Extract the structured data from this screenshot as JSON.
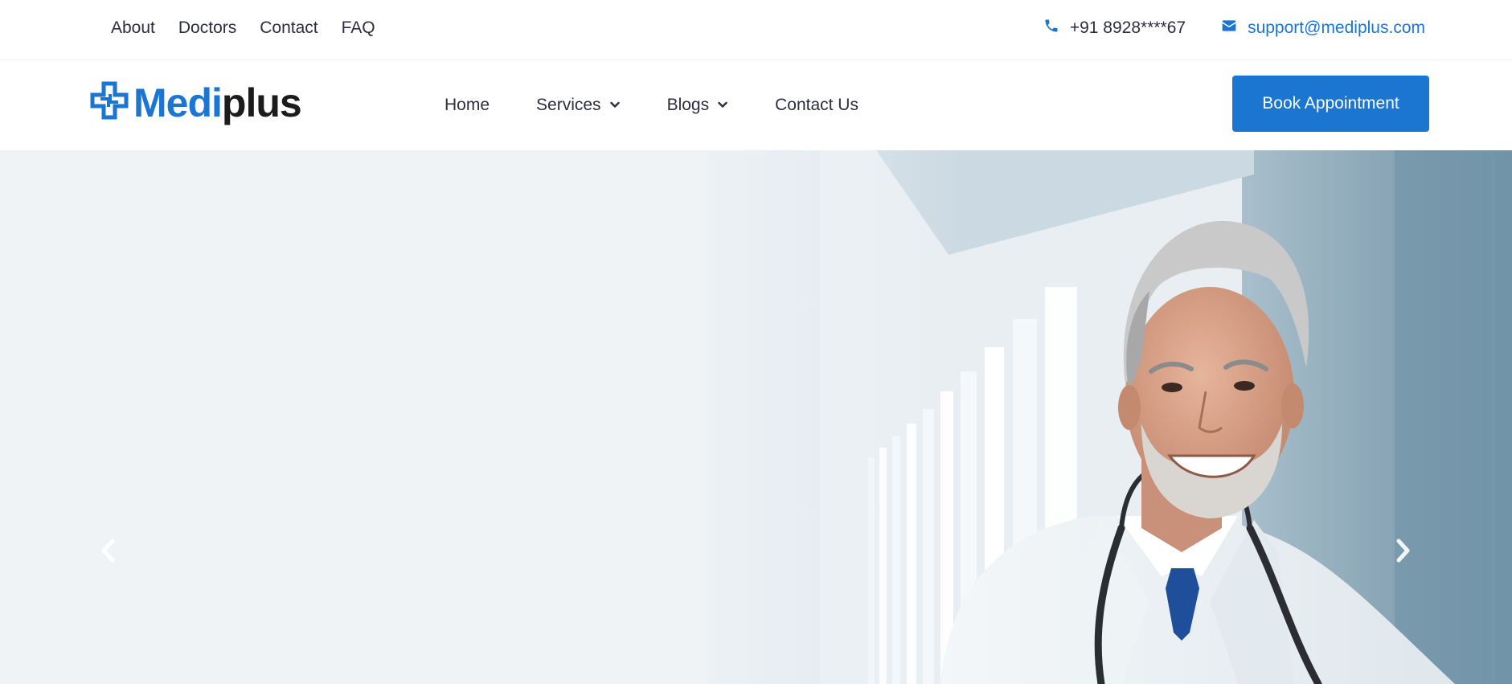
{
  "topbar": {
    "links": [
      "About",
      "Doctors",
      "Contact",
      "FAQ"
    ],
    "phone": "+91 8928****67",
    "email": "support@mediplus.com"
  },
  "header": {
    "logo": {
      "part1": "Medi",
      "part2": "plus"
    },
    "nav": [
      {
        "label": "Home",
        "dropdown": false
      },
      {
        "label": "Services",
        "dropdown": true
      },
      {
        "label": "Blogs",
        "dropdown": true
      },
      {
        "label": "Contact Us",
        "dropdown": false
      }
    ],
    "cta": "Book Appointment"
  },
  "hero": {
    "image": "smiling-doctor-in-hospital-corridor",
    "prev_icon": "chevron-left-icon",
    "next_icon": "chevron-right-icon"
  },
  "colors": {
    "accent": "#1a76d1",
    "text": "#2c2d3f",
    "hero_bg": "#eff3f6"
  }
}
